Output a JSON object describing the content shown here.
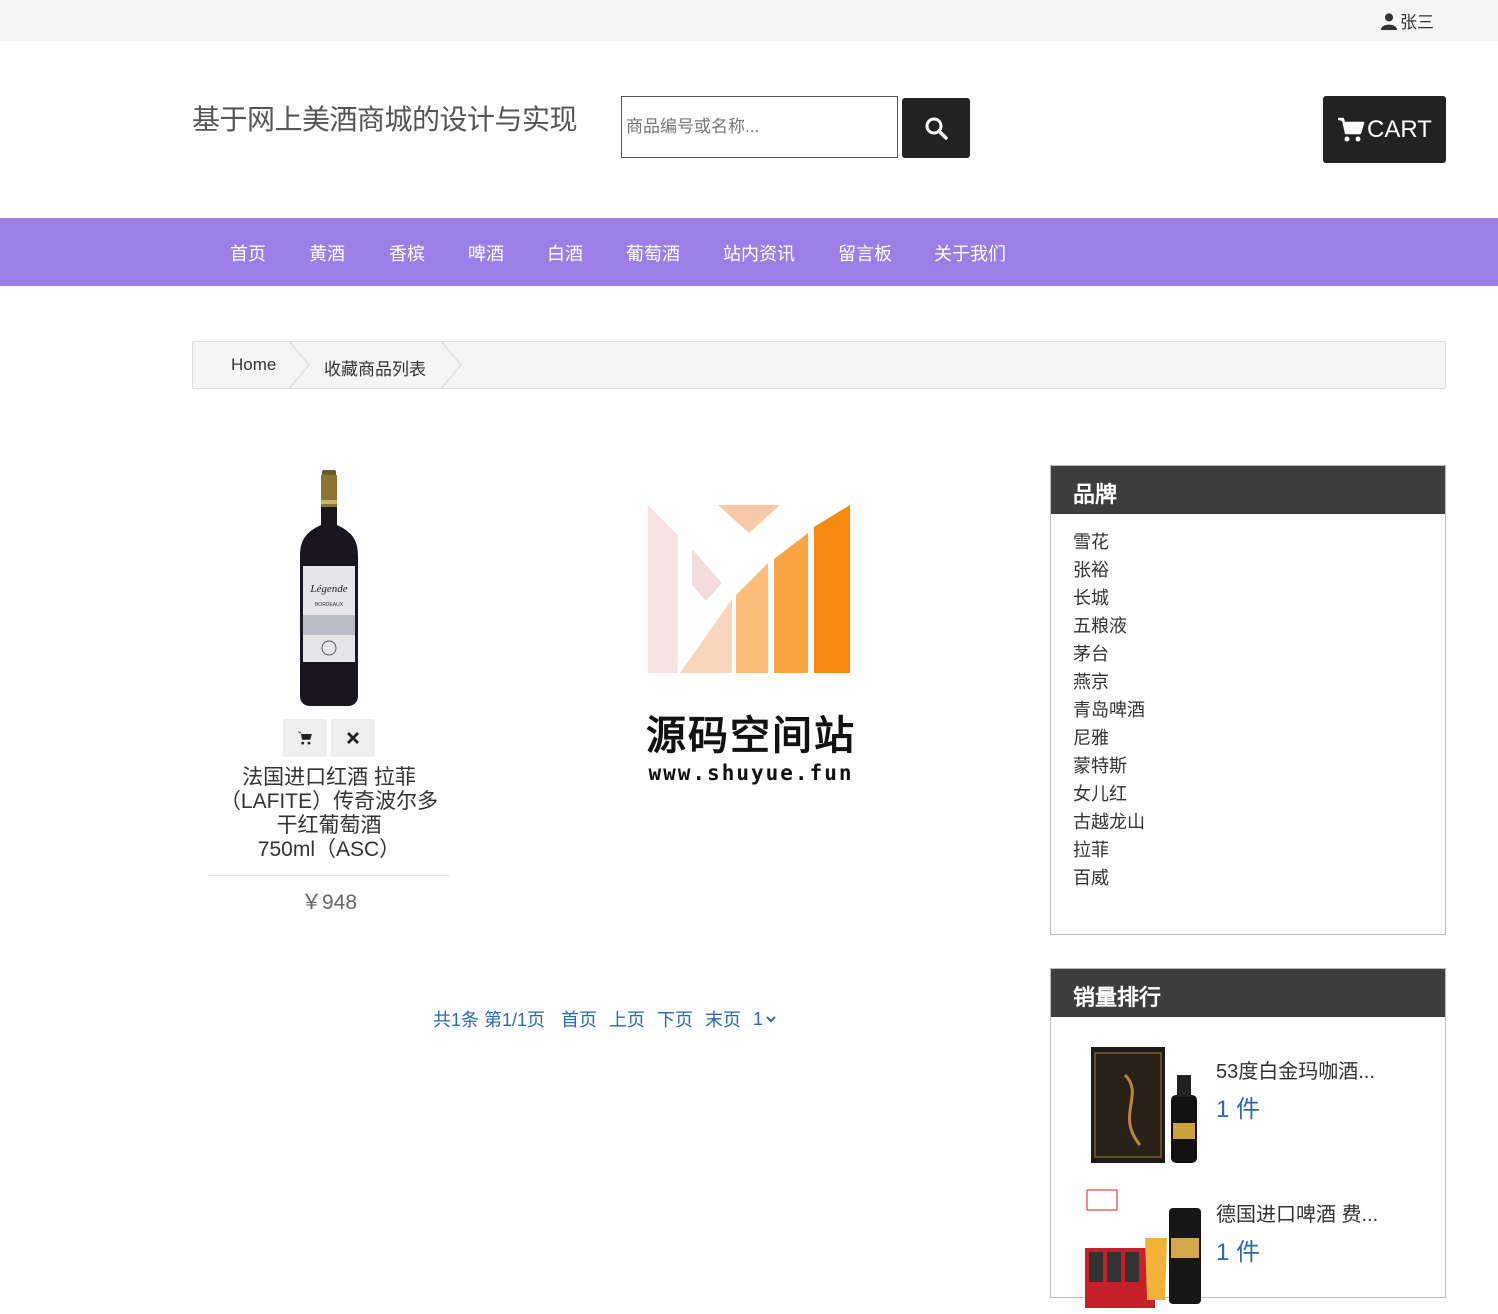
{
  "header": {
    "user_name": "张三",
    "site_title": "基于网上美酒商城的设计与实现",
    "search_placeholder": "商品编号或名称...",
    "cart_label": "CART"
  },
  "nav": {
    "items": [
      {
        "label": "首页"
      },
      {
        "label": "黄酒"
      },
      {
        "label": "香槟"
      },
      {
        "label": "啤酒"
      },
      {
        "label": "白酒"
      },
      {
        "label": "葡萄酒"
      },
      {
        "label": "站内资讯"
      },
      {
        "label": "留言板"
      },
      {
        "label": "关于我们"
      }
    ]
  },
  "breadcrumb": {
    "home": "Home",
    "current": "收藏商品列表"
  },
  "product": {
    "name_lines": [
      "法国进口红酒 拉菲",
      "（LAFITE）传奇波尔多",
      "干红葡萄酒",
      "750ml（ASC）"
    ],
    "price": "￥948",
    "bottle_label": "Légende",
    "bottle_sub": "BORDEAUX"
  },
  "watermark": {
    "title": "源码空间站",
    "url": "www.shuyue.fun"
  },
  "pager": {
    "info": "共1条 第1/1页",
    "first": "首页",
    "prev": "上页",
    "next": "下页",
    "last": "末页",
    "page_select": "1"
  },
  "brands": {
    "title": "品牌",
    "items": [
      "雪花",
      "张裕",
      "长城",
      "五粮液",
      "茅台",
      "燕京",
      "青岛啤酒",
      "尼雅",
      "蒙特斯",
      "女儿红",
      "古越龙山",
      "拉菲",
      "百威"
    ]
  },
  "sales_rank": {
    "title": "销量排行",
    "items": [
      {
        "name": "53度白金玛咖酒...",
        "count": "1 件"
      },
      {
        "name": "德国进口啤酒 费...",
        "count": "1 件"
      }
    ]
  },
  "colors": {
    "nav_bg": "#9b7fe6",
    "dark": "#222222",
    "link": "#2a6ab0",
    "panel_head": "#3d3d3d"
  }
}
